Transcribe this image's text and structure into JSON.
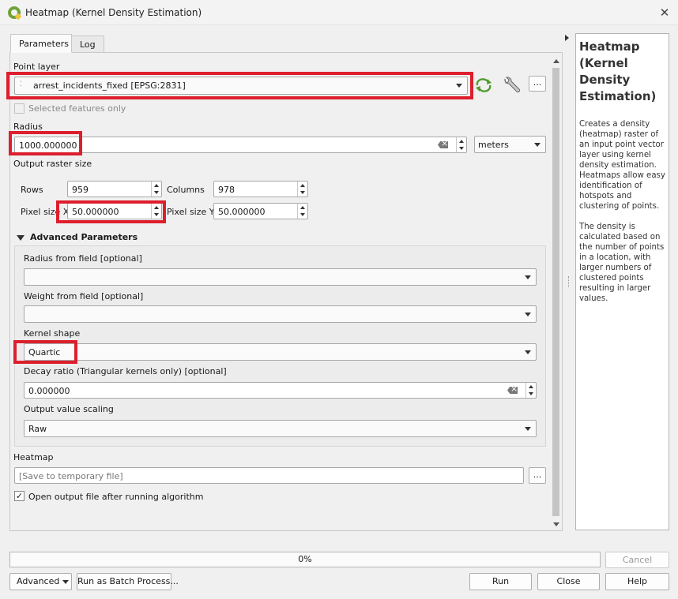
{
  "window": {
    "title": "Heatmap (Kernel Density Estimation)"
  },
  "tabs": [
    {
      "label": "Parameters"
    },
    {
      "label": "Log"
    }
  ],
  "point_layer": {
    "label": "Point layer",
    "value": "arrest_incidents_fixed [EPSG:2831]",
    "selected_only_label": "Selected features only",
    "more_label": "..."
  },
  "radius": {
    "label": "Radius",
    "value": "1000.000000",
    "unit": "meters"
  },
  "output_raster_size": {
    "label": "Output raster size",
    "rows_label": "Rows",
    "rows_value": "959",
    "columns_label": "Columns",
    "columns_value": "978",
    "pixel_x_label": "Pixel size X",
    "pixel_x_value": "50.000000",
    "pixel_y_label": "Pixel size Y",
    "pixel_y_value": "50.000000"
  },
  "advanced": {
    "header": "Advanced Parameters",
    "radius_field_label": "Radius from field [optional]",
    "weight_field_label": "Weight from field [optional]",
    "kernel_shape_label": "Kernel shape",
    "kernel_shape_value": "Quartic",
    "decay_label": "Decay ratio (Triangular kernels only) [optional]",
    "decay_value": "0.000000",
    "scaling_label": "Output value scaling",
    "scaling_value": "Raw"
  },
  "heatmap": {
    "label": "Heatmap",
    "placeholder": "[Save to temporary file]",
    "more_label": "...",
    "open_output_label": "Open output file after running algorithm"
  },
  "help": {
    "title": "Heatmap (Kernel Density Estimation)",
    "p1": "Creates a density (heatmap) raster of an input point vector layer using kernel density estimation. Heatmaps allow easy identification of hotspots and clustering of points.",
    "p2": "The density is calculated based on the number of points in a location, with larger numbers of clustered points resulting in larger values."
  },
  "progress": {
    "text": "0%",
    "percent": 0
  },
  "buttons": {
    "cancel": "Cancel",
    "advanced": "Advanced",
    "batch": "Run as Batch Process...",
    "run": "Run",
    "close": "Close",
    "help": "Help"
  }
}
